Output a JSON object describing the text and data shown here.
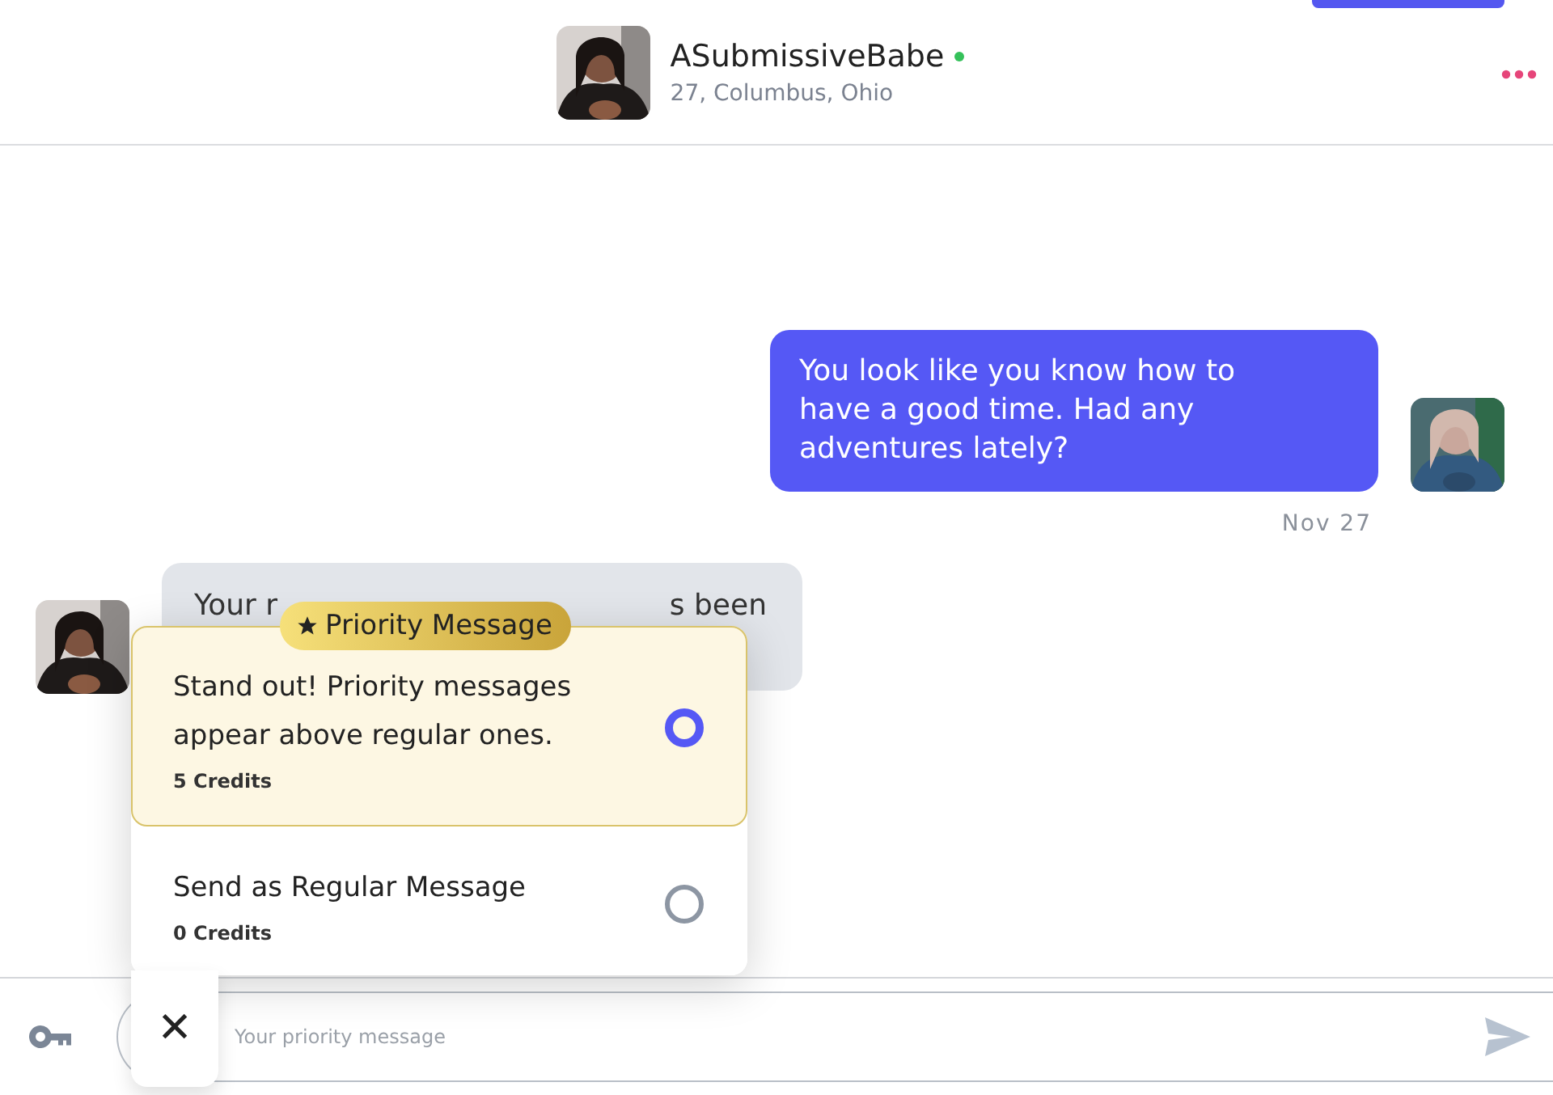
{
  "header": {
    "name": "ASubmissiveBabe",
    "online": true,
    "details": "27, Columbus, Ohio"
  },
  "messages": [
    {
      "kind": "sent",
      "text": "You look like you know how to have a good time. Had any adventures lately?",
      "date": "Nov 27"
    },
    {
      "kind": "received",
      "visible_fragments": [
        "Your r",
        "s been"
      ]
    }
  ],
  "priority_popup": {
    "badge": "Priority Message",
    "options": [
      {
        "title": "Stand out! Priority messages appear above regular ones.",
        "credits": "5 Credits",
        "selected": true,
        "highlighted": true
      },
      {
        "title": "Send as Regular Message",
        "credits": "0 Credits",
        "selected": false,
        "highlighted": false
      }
    ]
  },
  "composer": {
    "placeholder": "Your priority message",
    "close_label": "✕"
  }
}
